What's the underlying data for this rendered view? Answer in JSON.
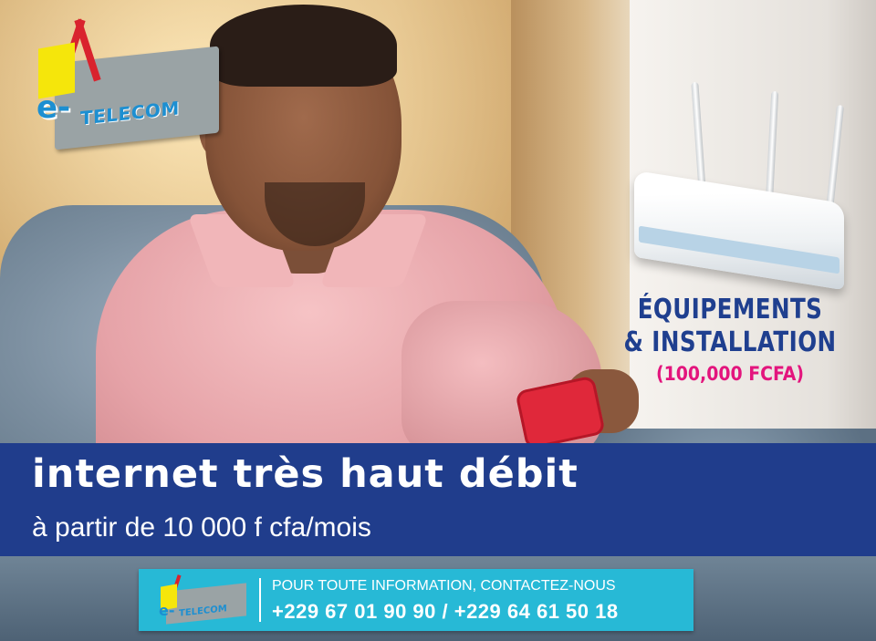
{
  "logo": {
    "prefix": "e-",
    "name": "TELECOM"
  },
  "equipment": {
    "line1": "ÉQUIPEMENTS",
    "line2": "& INSTALLATION",
    "price": "(100,000 FCFA)"
  },
  "headline": "internet très haut débit",
  "subline": "à partir de 10 000 f cfa/mois",
  "contact": {
    "logo_prefix": "e-",
    "logo_name": "TELECOM",
    "label": "POUR TOUTE INFORMATION, CONTACTEZ-NOUS",
    "phones": "+229 67 01 90 90 / +229 64 61 50 18"
  },
  "colors": {
    "band": "#203d8c",
    "headline": "#ffffff",
    "equipment_text": "#1f3f8f",
    "price_text": "#e3157d",
    "contact_box": "#27b9d6",
    "logo_blue": "#1d8fd1",
    "logo_yellow": "#f5e60b",
    "logo_red": "#d9232e"
  }
}
